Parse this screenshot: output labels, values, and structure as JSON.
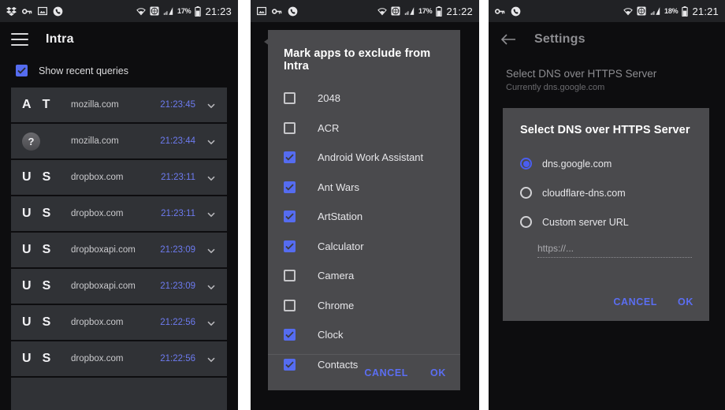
{
  "panels": [
    {
      "id": "intra-home",
      "statusbar": {
        "left_icons": [
          "dropbox-icon",
          "key-icon",
          "image-icon",
          "phone-icon"
        ],
        "right_icons": [
          "wifi-icon",
          "vpn-icon",
          "signal-icon"
        ],
        "battery_percent": "17%",
        "battery_icon": "battery-icon",
        "clock": "21:23"
      },
      "appbar": {
        "menu_icon": "hamburger-icon",
        "title": "Intra"
      },
      "recent_toggle": {
        "label": "Show recent queries",
        "checked": true
      },
      "queries": [
        {
          "g1": "A",
          "g2": "T",
          "host": "mozilla.com",
          "time": "21:23:45",
          "icon": "chevron-down-icon"
        },
        {
          "g1": "?",
          "g2": "",
          "host": "mozilla.com",
          "time": "21:23:44",
          "icon": "chevron-down-icon"
        },
        {
          "g1": "U",
          "g2": "S",
          "host": "dropbox.com",
          "time": "21:23:11",
          "icon": "chevron-down-icon"
        },
        {
          "g1": "U",
          "g2": "S",
          "host": "dropbox.com",
          "time": "21:23:11",
          "icon": "chevron-down-icon"
        },
        {
          "g1": "U",
          "g2": "S",
          "host": "dropboxapi.com",
          "time": "21:23:09",
          "icon": "chevron-down-icon"
        },
        {
          "g1": "U",
          "g2": "S",
          "host": "dropboxapi.com",
          "time": "21:23:09",
          "icon": "chevron-down-icon"
        },
        {
          "g1": "U",
          "g2": "S",
          "host": "dropbox.com",
          "time": "21:22:56",
          "icon": "chevron-down-icon"
        },
        {
          "g1": "U",
          "g2": "S",
          "host": "dropbox.com",
          "time": "21:22:56",
          "icon": "chevron-down-icon"
        }
      ]
    },
    {
      "id": "exclude-apps",
      "statusbar": {
        "left_icons": [
          "image-icon",
          "key-icon",
          "phone-icon"
        ],
        "right_icons": [
          "wifi-icon",
          "vpn-icon",
          "signal-icon"
        ],
        "battery_percent": "17%",
        "battery_icon": "battery-icon",
        "clock": "21:22"
      },
      "dialog": {
        "title": "Mark apps to exclude from Intra",
        "apps": [
          {
            "name": "2048",
            "checked": false
          },
          {
            "name": "ACR",
            "checked": false
          },
          {
            "name": "Android Work Assistant",
            "checked": true
          },
          {
            "name": "Ant Wars",
            "checked": true
          },
          {
            "name": "ArtStation",
            "checked": true
          },
          {
            "name": "Calculator",
            "checked": true
          },
          {
            "name": "Camera",
            "checked": false
          },
          {
            "name": "Chrome",
            "checked": false
          },
          {
            "name": "Clock",
            "checked": true
          },
          {
            "name": "Contacts",
            "checked": true
          }
        ],
        "cancel_label": "CANCEL",
        "ok_label": "OK"
      }
    },
    {
      "id": "dns-settings",
      "statusbar": {
        "left_icons": [
          "key-icon",
          "phone-icon"
        ],
        "right_icons": [
          "wifi-icon",
          "vpn-icon",
          "signal-icon"
        ],
        "battery_percent": "18%",
        "battery_icon": "battery-icon",
        "clock": "21:21"
      },
      "appbar": {
        "back_icon": "back-arrow-icon",
        "title": "Settings"
      },
      "settings": {
        "item_title": "Select DNS over HTTPS Server",
        "item_subtitle": "Currently dns.google.com"
      },
      "dialog": {
        "title": "Select DNS over HTTPS Server",
        "options": [
          {
            "label": "dns.google.com",
            "selected": true
          },
          {
            "label": "cloudflare-dns.com",
            "selected": false
          },
          {
            "label": "Custom server URL",
            "selected": false
          }
        ],
        "url_placeholder": "https://...",
        "cancel_label": "CANCEL",
        "ok_label": "OK"
      }
    }
  ],
  "colors": {
    "accent_blue": "#556cf0",
    "link_blue": "#5b6ef2",
    "time_blue": "#6d7bf0",
    "page_bg": "#0d0d0f",
    "card_bg": "#303236",
    "dialog_bg": "#4a4a4d",
    "statusbar_bg": "#212225"
  }
}
